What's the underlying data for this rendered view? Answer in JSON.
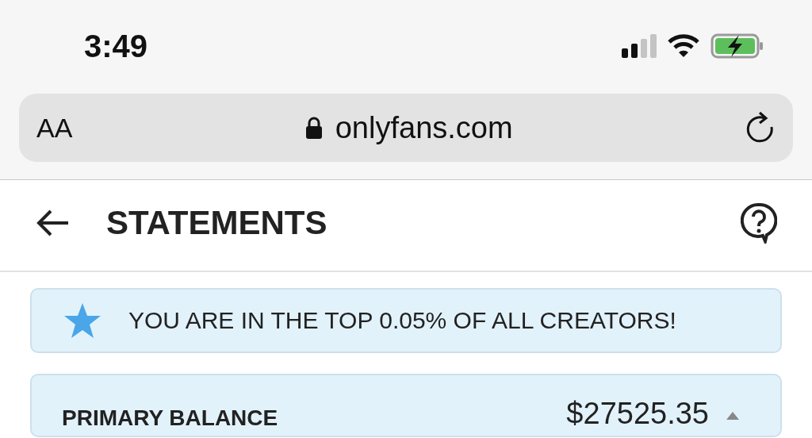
{
  "status_bar": {
    "time": "3:49"
  },
  "address_bar": {
    "text_size": "AA",
    "url": "onlyfans.com"
  },
  "header": {
    "title": "STATEMENTS"
  },
  "banner": {
    "text": "YOU ARE IN THE TOP 0.05% OF ALL CREATORS!"
  },
  "balance_card": {
    "label": "PRIMARY BALANCE",
    "amount": "$27525.35"
  }
}
